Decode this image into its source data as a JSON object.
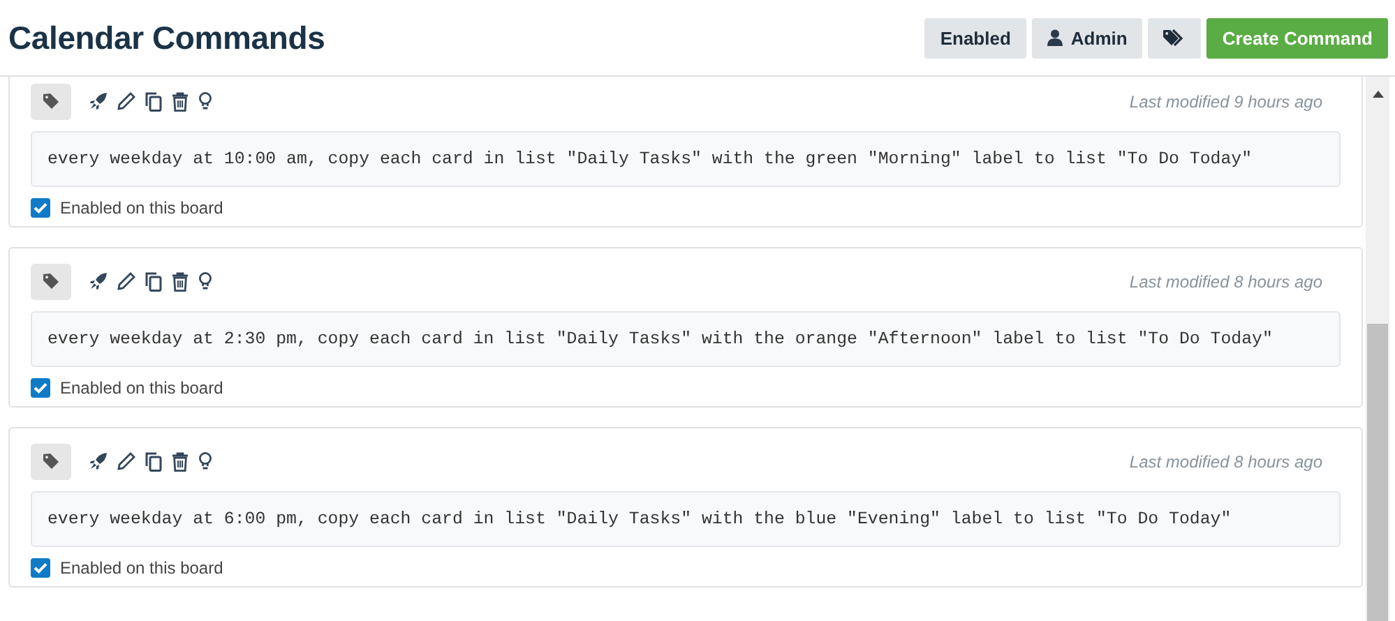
{
  "title": "Calendar Commands",
  "header_buttons": [
    {
      "kind": "text",
      "label": "Enabled"
    },
    {
      "kind": "user",
      "label": "Admin"
    },
    {
      "kind": "tags"
    },
    {
      "kind": "primary",
      "label": "Create Command"
    }
  ],
  "commands": [
    {
      "modified": "Last modified 9 hours ago",
      "text": "every weekday at 10:00 am, copy each card in list \"Daily Tasks\" with the green \"Morning\" label to list \"To Do Today\"",
      "enabled": true,
      "enabled_label": "Enabled on this board"
    },
    {
      "modified": "Last modified 8 hours ago",
      "text": "every weekday at 2:30 pm, copy each card in list \"Daily Tasks\" with the orange \"Afternoon\" label to list \"To Do Today\"",
      "enabled": true,
      "enabled_label": "Enabled on this board"
    },
    {
      "modified": "Last modified 8 hours ago",
      "text": "every weekday at 6:00 pm, copy each card in list \"Daily Tasks\" with the blue \"Evening\" label to list \"To Do Today\"",
      "enabled": true,
      "enabled_label": "Enabled on this board"
    }
  ]
}
